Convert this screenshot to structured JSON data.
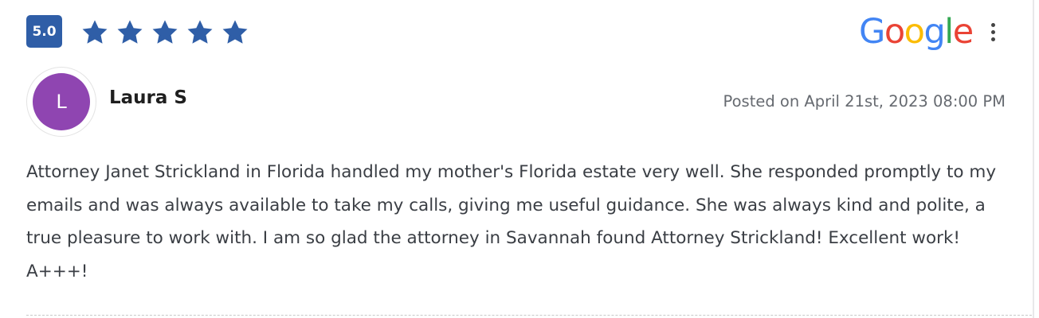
{
  "review": {
    "rating_value": "5.0",
    "star_count": 5,
    "star_color": "#2f5ea7",
    "badge_color": "#2f5ea7",
    "source_logo": {
      "letters": [
        "G",
        "o",
        "o",
        "g",
        "l",
        "e"
      ],
      "colors": [
        "#4285F4",
        "#EA4335",
        "#FBBC05",
        "#4285F4",
        "#34A853",
        "#EA4335"
      ]
    },
    "more_icon": "more-vertical-icon",
    "reviewer": {
      "initial": "L",
      "avatar_color": "#8f45b1",
      "name": "Laura S"
    },
    "posted": "Posted on April 21st, 2023 08:00 PM",
    "text": "Attorney Janet Strickland in Florida handled my mother's Florida estate very well. She responded promptly to my emails and was always available to take my calls, giving me useful guidance. She was always kind and polite, a true pleasure to work with. I am so glad the attorney in Savannah found Attorney Strickland! Excellent work! A+++!"
  }
}
